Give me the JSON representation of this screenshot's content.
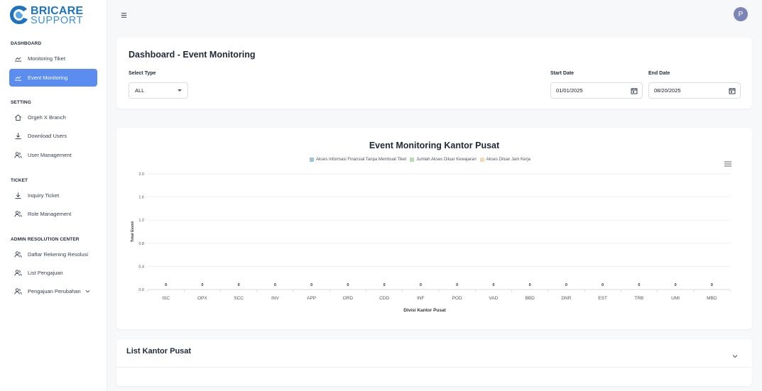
{
  "brand": {
    "line1": "BRICARE",
    "line2": "SUPPORT"
  },
  "sidebar": {
    "sections": [
      {
        "label": "DASHBOARD"
      },
      {
        "label": "SETTING"
      },
      {
        "label": "TICKET"
      },
      {
        "label": "ADMIN RESOLUTION CENTER"
      }
    ],
    "items": [
      {
        "label": "Monitoring Tiket",
        "icon": "chart-line-icon"
      },
      {
        "label": "Event Monitoring",
        "icon": "chart-line-icon",
        "active": true
      },
      {
        "label": "Orgeh X Branch",
        "icon": "home-icon"
      },
      {
        "label": "Download Users",
        "icon": "download-icon"
      },
      {
        "label": "User Management",
        "icon": "users-icon"
      },
      {
        "label": "Inquiry Ticket",
        "icon": "download-icon"
      },
      {
        "label": "Role Management",
        "icon": "users-icon"
      },
      {
        "label": "Daftar Rekening Resolusi",
        "icon": "users-icon"
      },
      {
        "label": "List Pengajuan",
        "icon": "users-icon"
      },
      {
        "label": "Pengajuan Perubahan",
        "icon": "users-icon"
      }
    ]
  },
  "header": {
    "avatar_initial": "P",
    "menu_icon": "hamburger-icon"
  },
  "filters": {
    "title": "Dashboard - Event Monitoring",
    "type_label": "Select Type",
    "type_value": "ALL",
    "start_label": "Start Date",
    "start_value": "01/01/2025",
    "end_label": "End Date",
    "end_value": "08/20/2025"
  },
  "chart_data": {
    "type": "bar",
    "title": "Event Monitoring Kantor Pusat",
    "xlabel": "Divisi Kantor Pusat",
    "ylabel": "Total Event",
    "ylim": [
      0,
      2.0
    ],
    "yticks": [
      "0.0",
      "0.4",
      "0.8",
      "1.2",
      "1.6",
      "2.0"
    ],
    "categories": [
      "ISC",
      "OPX",
      "SCC",
      "INV",
      "APP",
      "ORD",
      "CDD",
      "INF",
      "POD",
      "VAD",
      "BBD",
      "DNR",
      "EST",
      "TRB",
      "UMI",
      "MBD"
    ],
    "series": [
      {
        "name": "Akses Informasi Finansial Tanpa Membuat Tiket",
        "color": "#9ec3d8",
        "values": [
          0,
          0,
          0,
          0,
          0,
          0,
          0,
          0,
          0,
          0,
          0,
          0,
          0,
          0,
          0,
          0
        ]
      },
      {
        "name": "Jumlah Akses Diluar Kewajaran",
        "color": "#b6dcb0",
        "values": [
          0,
          0,
          0,
          0,
          0,
          0,
          0,
          0,
          0,
          0,
          0,
          0,
          0,
          0,
          0,
          0
        ]
      },
      {
        "name": "Akses Diluar Jam Kerja",
        "color": "#f5d6b5",
        "values": [
          0,
          0,
          0,
          0,
          0,
          0,
          0,
          0,
          0,
          0,
          0,
          0,
          0,
          0,
          0,
          0
        ]
      }
    ],
    "data_labels": [
      "0",
      "0",
      "0",
      "0",
      "0",
      "0",
      "0",
      "0",
      "0",
      "0",
      "0",
      "0",
      "0",
      "0",
      "0",
      "0"
    ],
    "grid": true,
    "legend": "top"
  },
  "list": {
    "title": "List Kantor Pusat"
  }
}
